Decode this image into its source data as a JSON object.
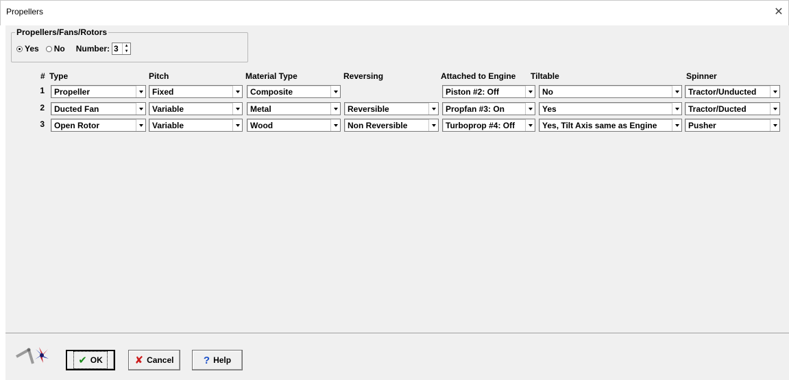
{
  "window": {
    "title": "Propellers",
    "close_glyph": "✕"
  },
  "group": {
    "legend": "Propellers/Fans/Rotors",
    "yes_label": "Yes",
    "no_label": "No",
    "selected": "Yes",
    "number_label": "Number:",
    "number_value": "3"
  },
  "columns": {
    "num": "#",
    "type": "Type",
    "pitch": "Pitch",
    "material": "Material Type",
    "reversing": "Reversing",
    "engine": "Attached to Engine",
    "tiltable": "Tiltable",
    "spinner": "Spinner"
  },
  "rows": [
    {
      "num": "1",
      "type": "Propeller",
      "pitch": "Fixed",
      "material": "Composite",
      "reversing": "",
      "engine": "Piston #2: Off",
      "tiltable": "No",
      "spinner": "Tractor/Unducted"
    },
    {
      "num": "2",
      "type": "Ducted Fan",
      "pitch": "Variable",
      "material": "Metal",
      "reversing": "Reversible",
      "engine": "Propfan #3: On",
      "tiltable": "Yes",
      "spinner": "Tractor/Ducted"
    },
    {
      "num": "3",
      "type": "Open Rotor",
      "pitch": "Variable",
      "material": "Wood",
      "reversing": "Non Reversible",
      "engine": "Turboprop #4: Off",
      "tiltable": "Yes, Tilt Axis same as Engine",
      "spinner": "Pusher"
    }
  ],
  "footer": {
    "logo_icon": "propeller-fan-logo-icon",
    "ok_label": "OK",
    "cancel_label": "Cancel",
    "help_label": "Help",
    "ok_glyph": "✔",
    "cancel_glyph": "✘",
    "help_glyph": "?"
  }
}
